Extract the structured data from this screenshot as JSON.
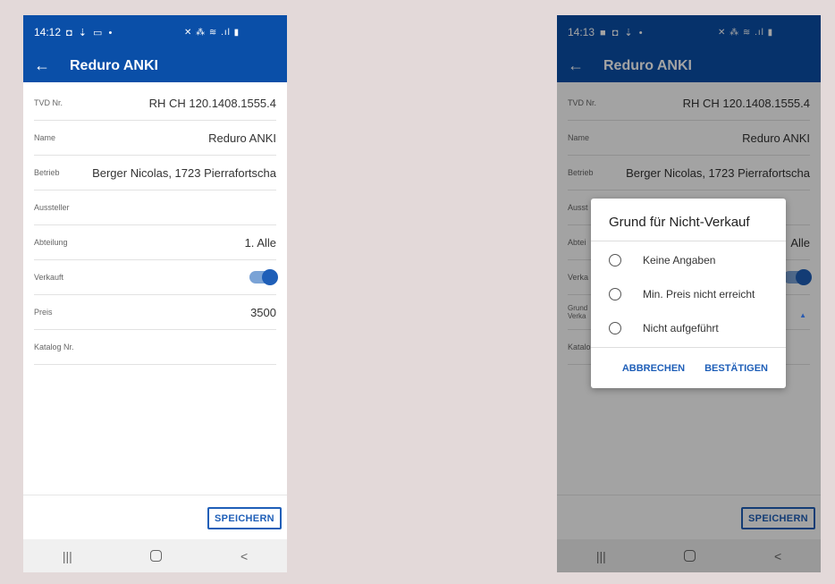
{
  "left": {
    "status_time": "14:12",
    "status_icons": "◘ ⇣ ▭ •",
    "status_right": "✕ ⁂ ≋ .ıl ▮",
    "title": "Reduro ANKI",
    "rows": [
      {
        "label": "TVD Nr.",
        "value": "RH CH 120.1408.1555.4"
      },
      {
        "label": "Name",
        "value": "Reduro ANKI"
      },
      {
        "label": "Betrieb",
        "value": "Berger Nicolas, 1723 Pierrafortscha"
      },
      {
        "label": "Aussteller",
        "value": ""
      },
      {
        "label": "Abteilung",
        "value": "1. Alle"
      },
      {
        "label": "Verkauft",
        "value": ""
      },
      {
        "label": "Preis",
        "value": "3500"
      },
      {
        "label": "Katalog Nr.",
        "value": ""
      }
    ],
    "save_label": "SPEICHERN"
  },
  "right": {
    "status_time": "14:13",
    "status_icons": "■ ◘ ⇣ •",
    "status_right": "✕ ⁂ ≋ .ıl ▮",
    "title": "Reduro ANKI",
    "rows": [
      {
        "label": "TVD Nr.",
        "value": "RH CH 120.1408.1555.4"
      },
      {
        "label": "Name",
        "value": "Reduro ANKI"
      },
      {
        "label": "Betrieb",
        "value": "Berger Nicolas, 1723 Pierrafortscha"
      },
      {
        "label": "Ausst",
        "value": ""
      },
      {
        "label": "Abtei",
        "value": "Alle"
      },
      {
        "label": "Verka",
        "value": ""
      },
      {
        "label": "Grund Verka",
        "value": ""
      },
      {
        "label": "Katalo",
        "value": ""
      }
    ],
    "save_label": "SPEICHERN",
    "dialog": {
      "title": "Grund für Nicht-Verkauf",
      "options": [
        "Keine Angaben",
        "Min. Preis nicht erreicht",
        "Nicht aufgeführt"
      ],
      "cancel": "ABBRECHEN",
      "confirm": "BESTÄTIGEN"
    }
  },
  "nav": {
    "recents": "|||",
    "back": "<"
  },
  "colors": {
    "primary": "#0a4fa8",
    "accent": "#1f5fb8",
    "background": "#e3d9d9"
  },
  "icons": {
    "back": "arrow-left-icon",
    "toggle": "toggle-on",
    "dropdown": "caret-up-icon"
  },
  "verkauft_toggle_on": true
}
